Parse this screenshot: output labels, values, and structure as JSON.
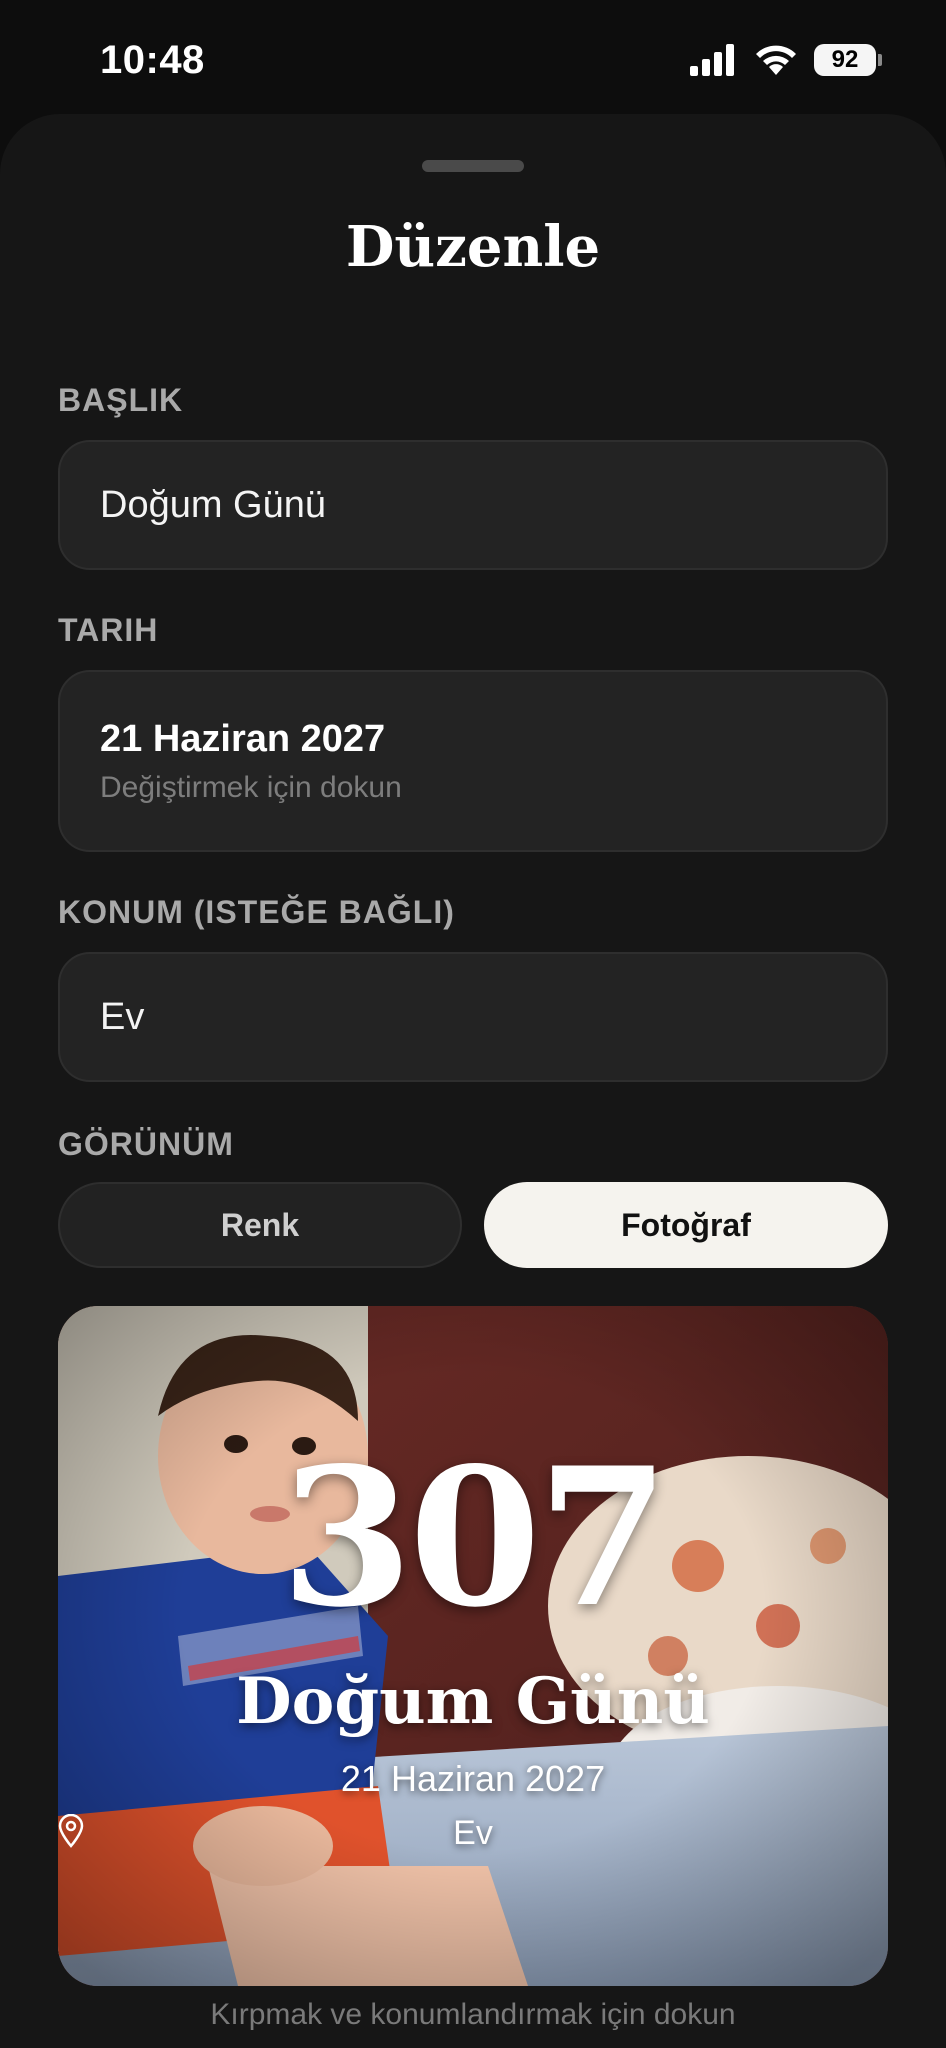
{
  "status_bar": {
    "time": "10:48",
    "battery": "92"
  },
  "sheet": {
    "title": "Düzenle"
  },
  "fields": {
    "title_label": "BAŞLIK",
    "title_value": "Doğum Günü",
    "date_label": "TARIH",
    "date_value": "21 Haziran 2027",
    "date_hint": "Değiştirmek için dokun",
    "location_label": "KONUM (ISTEĞE BAĞLI)",
    "location_value": "Ev"
  },
  "appearance": {
    "label": "GÖRÜNÜM",
    "options": [
      "Renk",
      "Fotoğraf"
    ],
    "selected": "Fotoğraf"
  },
  "preview": {
    "count": "307",
    "title": "Doğum Günü",
    "date": "21 Haziran 2027",
    "location": "Ev",
    "hint": "Kırpmak ve konumlandırmak için dokun"
  }
}
